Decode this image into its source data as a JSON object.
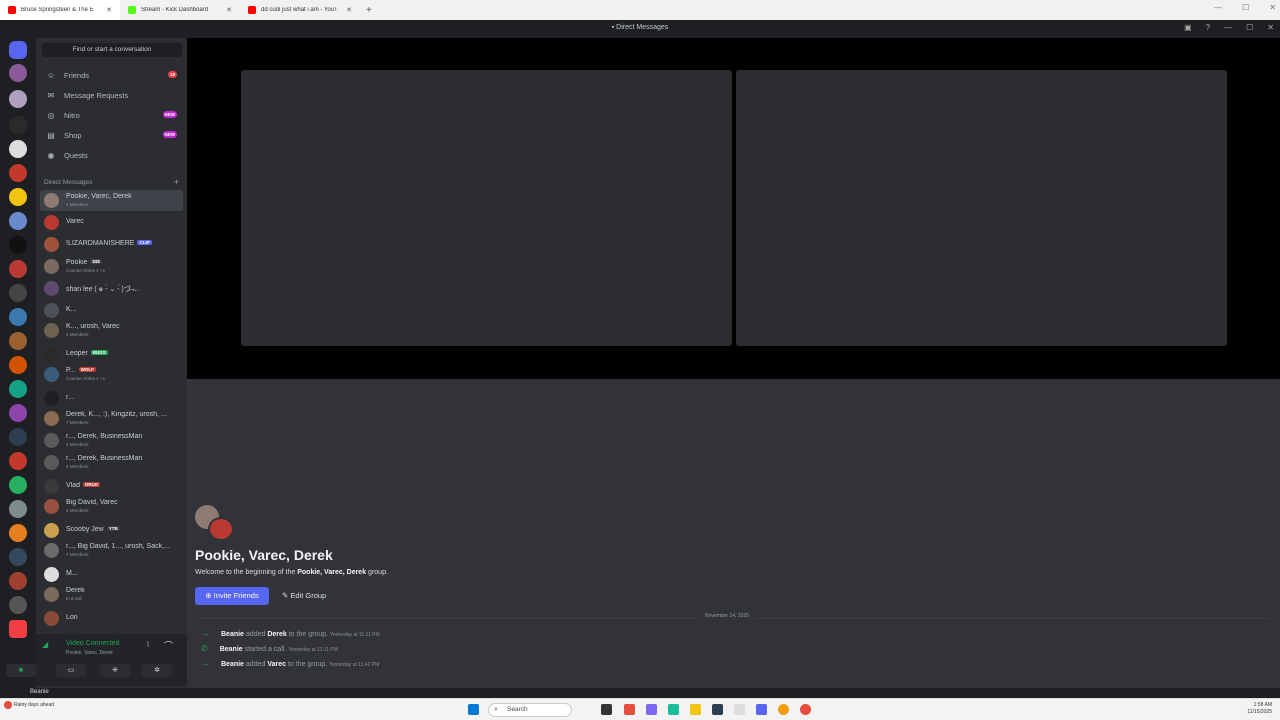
{
  "browser": {
    "tabs": [
      {
        "title": "Bruce Springsteen & The E",
        "color": "#ff0000",
        "active": true
      },
      {
        "title": "Stream - Kick Dashboard",
        "color": "#53fc18"
      },
      {
        "title": "dd cudi just what i am - YouTu",
        "color": "#ff0000"
      }
    ],
    "new_tab": "+"
  },
  "titlebar": {
    "title": "Direct Messages"
  },
  "sidebar": {
    "search_placeholder": "Find or start a conversation",
    "nav": [
      {
        "label": "Friends",
        "icon": "friends-icon",
        "badge": "18",
        "badge_color": "#f23f43"
      },
      {
        "label": "Message Requests",
        "icon": "mail-icon"
      },
      {
        "label": "Nitro",
        "icon": "nitro-icon",
        "badge": "NEW",
        "badge_color": "#c026d3"
      },
      {
        "label": "Shop",
        "icon": "shop-icon",
        "badge": "NEW",
        "badge_color": "#c026d3"
      },
      {
        "label": "Quests",
        "icon": "quests-icon"
      }
    ],
    "dm_header": "Direct Messages",
    "dms": [
      {
        "name": "Pookie, Varec, Derek",
        "sub": "4 Members",
        "selected": true,
        "color": "#8e7b73"
      },
      {
        "name": "Varec",
        "color": "#b83a32"
      },
      {
        "name": "!LIZARDMANISHERE",
        "tag": "CLIP",
        "tag_color": "#5865f2",
        "color": "#a0523d"
      },
      {
        "name": "Pookie",
        "tag": "$$$",
        "tag_color": "#3a3c42",
        "sub": "Counter-Strike 2 +1",
        "color": "#7a6a60"
      },
      {
        "name": "shan lee ( ๑ -̀ ⌄ -́ )づ ̶̶̶̶̶̶̶...",
        "color": "#5e4a70"
      },
      {
        "name": "K...",
        "color": "#4e5058"
      },
      {
        "name": "K..., urosh, Varec",
        "sub": "4 Members",
        "color": "#6d6250"
      },
      {
        "name": "Leoper",
        "tag": "RUGS",
        "tag_color": "#23a55a",
        "color": "#2a2a2a"
      },
      {
        "name": "P...",
        "tag": "WOLF",
        "tag_color": "#b83a32",
        "sub": "Counter-Strike 2 +1",
        "color": "#3b5b7a"
      },
      {
        "name": "r...",
        "color": "#1e1f22"
      },
      {
        "name": "Derek, K..., :), Kingzitz, urosh, ...",
        "sub": "7 Members",
        "color": "#8a6a50"
      },
      {
        "name": "r..., Derek, BusinessMan",
        "sub": "4 Members",
        "color": "#5a5a5a"
      },
      {
        "name": "r..., Derek, BusinessMan",
        "sub": "4 Members",
        "color": "#5a5a5a"
      },
      {
        "name": "Vlad",
        "tag": "DRUG",
        "tag_color": "#b83a32",
        "color": "#3a3a3a"
      },
      {
        "name": "Big David, Varec",
        "sub": "3 Members",
        "color": "#9a5040"
      },
      {
        "name": "Scooby Jew",
        "tag": "YTB",
        "tag_color": "#3a3c42",
        "color": "#c9a050"
      },
      {
        "name": "r..., Big David, 1..., urosh, Sack,...",
        "sub": "7 Members",
        "color": "#6a6a6a"
      },
      {
        "name": "M...",
        "color": "#dddddd"
      },
      {
        "name": "Derek",
        "sub": "In a call",
        "color": "#7a6a5a"
      },
      {
        "name": "Lon",
        "color": "#8a4a3a"
      }
    ]
  },
  "voice": {
    "status": "Video Connected",
    "channel": "Pookie, Varec, Derek"
  },
  "user": {
    "name": "Beanie"
  },
  "main": {
    "group_name": "Pookie, Varec, Derek",
    "welcome_prefix": "Welcome to the beginning of the ",
    "welcome_name": "Pookie, Varec, Derek",
    "welcome_suffix": " group.",
    "invite_label": "Invite Friends",
    "edit_label": "Edit Group",
    "date_divider": "November 14, 2025",
    "events": [
      {
        "actor": "Beanie",
        "verb": " added ",
        "target": "Derek",
        "tail": " to the group. ",
        "time": "Yesterday at 11:11 PM",
        "icon": "arrow-icon"
      },
      {
        "actor": "Beanie",
        "verb": " started a call. ",
        "target": "",
        "tail": "",
        "time": "Yesterday at 11:11 PM",
        "icon": "phone-icon"
      },
      {
        "actor": "Beanie",
        "verb": " added ",
        "target": "Varec",
        "tail": " to the group. ",
        "time": "Yesterday at 11:42 PM",
        "icon": "arrow-icon"
      }
    ]
  },
  "taskbar": {
    "weather": "Rainy days ahead",
    "search": "Search",
    "time": "1:58 AM",
    "date": "11/15/2025"
  }
}
